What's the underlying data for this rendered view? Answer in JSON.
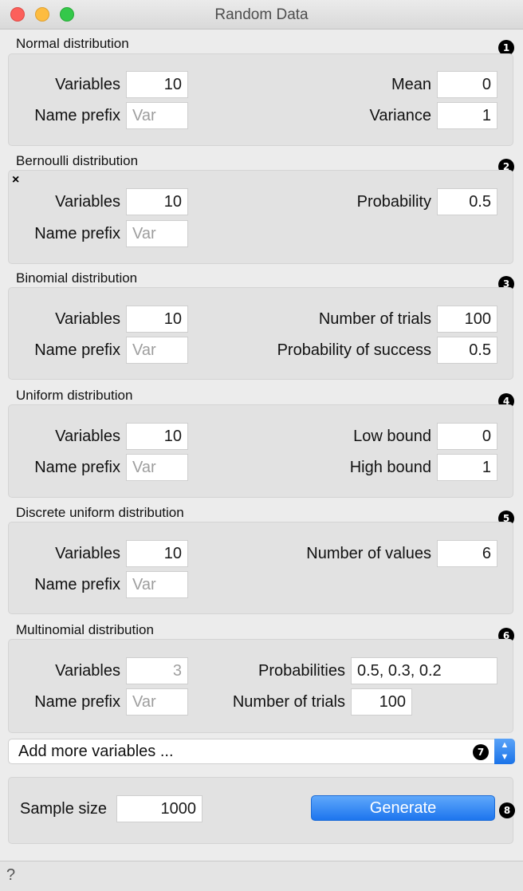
{
  "window": {
    "title": "Random Data"
  },
  "sections": {
    "normal": {
      "title": "Normal distribution",
      "badge": "1",
      "variables_label": "Variables",
      "variables_value": "10",
      "prefix_label": "Name prefix",
      "prefix_placeholder": "Var",
      "mean_label": "Mean",
      "mean_value": "0",
      "variance_label": "Variance",
      "variance_value": "1"
    },
    "bernoulli": {
      "title": "Bernoulli distribution",
      "badge": "2",
      "remove_glyph": "×",
      "variables_label": "Variables",
      "variables_value": "10",
      "prefix_label": "Name prefix",
      "prefix_placeholder": "Var",
      "probability_label": "Probability",
      "probability_value": "0.5"
    },
    "binomial": {
      "title": "Binomial distribution",
      "badge": "3",
      "variables_label": "Variables",
      "variables_value": "10",
      "prefix_label": "Name prefix",
      "prefix_placeholder": "Var",
      "trials_label": "Number of trials",
      "trials_value": "100",
      "success_label": "Probability of success",
      "success_value": "0.5"
    },
    "uniform": {
      "title": "Uniform distribution",
      "badge": "4",
      "variables_label": "Variables",
      "variables_value": "10",
      "prefix_label": "Name prefix",
      "prefix_placeholder": "Var",
      "low_label": "Low bound",
      "low_value": "0",
      "high_label": "High bound",
      "high_value": "1"
    },
    "discrete": {
      "title": "Discrete uniform distribution",
      "badge": "5",
      "variables_label": "Variables",
      "variables_value": "10",
      "prefix_label": "Name prefix",
      "prefix_placeholder": "Var",
      "values_label": "Number of values",
      "values_value": "6"
    },
    "multinomial": {
      "title": "Multinomial distribution",
      "badge": "6",
      "variables_label": "Variables",
      "variables_value": "3",
      "prefix_label": "Name prefix",
      "prefix_placeholder": "Var",
      "probs_label": "Probabilities",
      "probs_value": "0.5, 0.3, 0.2",
      "trials_label": "Number of trials",
      "trials_value": "100"
    }
  },
  "add_more": {
    "label": "Add more variables ...",
    "badge": "7"
  },
  "footer": {
    "sample_label": "Sample size",
    "sample_value": "1000",
    "generate_label": "Generate",
    "badge": "8"
  },
  "statusbar": {
    "help_glyph": "?"
  },
  "colors": {
    "accent": "#1d75ee",
    "background": "#ececec",
    "group": "#e2e2e2"
  }
}
